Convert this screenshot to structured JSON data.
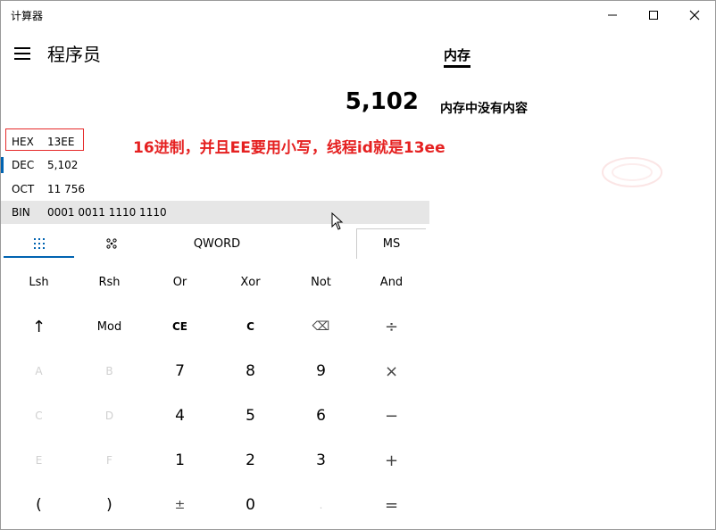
{
  "window": {
    "title": "计算器"
  },
  "header": {
    "mode_title": "程序员"
  },
  "memory": {
    "tab_label": "内存",
    "empty_text": "内存中没有内容"
  },
  "display": {
    "value": "5,102"
  },
  "radix": [
    {
      "label": "HEX",
      "value": "13EE"
    },
    {
      "label": "DEC",
      "value": "5,102"
    },
    {
      "label": "OCT",
      "value": "11 756"
    },
    {
      "label": "BIN",
      "value": "0001 0011 1110 1110"
    }
  ],
  "annotation": {
    "text": "16进制，并且EE要用小写，线程id就是13ee",
    "color": "#e52121"
  },
  "toolbar": {
    "keypad_icon": "full-keypad-icon",
    "bit_icon": "bit-toggle-icon",
    "word_size": "QWORD",
    "ms_label": "MS"
  },
  "keys": {
    "row1": [
      "Lsh",
      "Rsh",
      "Or",
      "Xor",
      "Not",
      "And"
    ],
    "row2": [
      "↑",
      "Mod",
      "CE",
      "C",
      "⌫",
      "÷"
    ],
    "row3": [
      "A",
      "B",
      "7",
      "8",
      "9",
      "×"
    ],
    "row4": [
      "C",
      "D",
      "4",
      "5",
      "6",
      "−"
    ],
    "row5": [
      "E",
      "F",
      "1",
      "2",
      "3",
      "+"
    ],
    "row6": [
      "(",
      ")",
      "±",
      "0",
      ".",
      "="
    ]
  },
  "colors": {
    "accent": "#0063b1",
    "highlight_box": "#e52b2b",
    "bin_row_bg": "#e6e6e6",
    "disabled_key": "#d0d0d0"
  }
}
